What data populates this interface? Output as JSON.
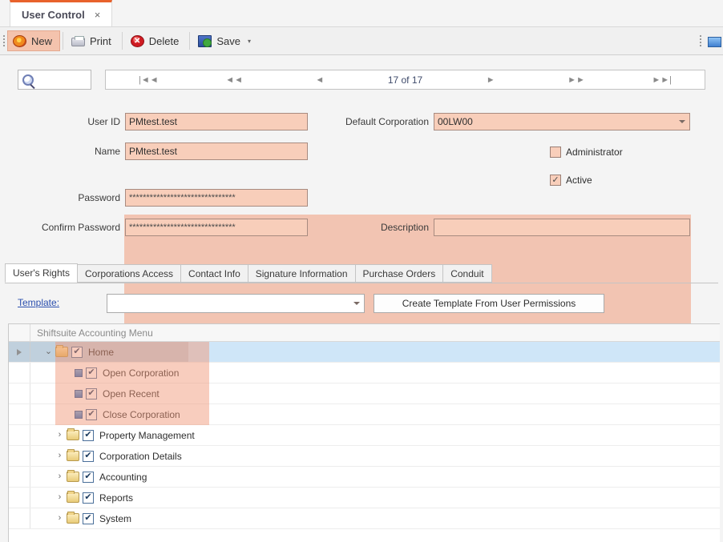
{
  "window": {
    "document_tab": {
      "title": "User Control",
      "close_label": "×"
    }
  },
  "toolbar": {
    "buttons": [
      {
        "label": "New",
        "icon": "new-record-icon",
        "active": true
      },
      {
        "label": "Print",
        "icon": "printer-icon",
        "active": false
      },
      {
        "label": "Delete",
        "icon": "delete-circle-icon",
        "active": false
      },
      {
        "label": "Save",
        "icon": "save-disk-icon",
        "active": false,
        "caret": "▾"
      }
    ]
  },
  "navigator": {
    "search_placeholder": "",
    "search_value": "",
    "first_label": "|◄◄",
    "prev_page_label": "◄◄",
    "prev_label": "◄",
    "position": "17 of 17",
    "next_label": "►",
    "next_page_label": "►►",
    "last_label": "►►|"
  },
  "form": {
    "user_id": {
      "label": "User ID",
      "value": "PMtest.test"
    },
    "name": {
      "label": "Name",
      "value": "PMtest.test"
    },
    "password": {
      "label": "Password",
      "value": "*******************************"
    },
    "confirm_password": {
      "label": "Confirm Password",
      "value": "*******************************"
    },
    "default_corporation": {
      "label": "Default Corporation",
      "value": "00LW00"
    },
    "administrator": {
      "label": "Administrator",
      "checked": false,
      "mark": ""
    },
    "active": {
      "label": "Active",
      "checked": true,
      "mark": "✓"
    },
    "description": {
      "label": "Description",
      "value": ""
    }
  },
  "tabs": [
    {
      "label": "User's Rights",
      "selected": true
    },
    {
      "label": "Corporations Access",
      "selected": false
    },
    {
      "label": "Contact Info",
      "selected": false
    },
    {
      "label": "Signature Information",
      "selected": false
    },
    {
      "label": "Purchase Orders",
      "selected": false
    },
    {
      "label": "Conduit",
      "selected": false
    }
  ],
  "template": {
    "label": "Template:",
    "combo_value": "",
    "create_button": "Create Template From User Permissions"
  },
  "tree": {
    "column_header": "Shiftsuite Accounting Menu",
    "rows": [
      {
        "label": "Home",
        "level": 0,
        "type": "folder-open",
        "expander": "⌄",
        "checked": true,
        "selected": true,
        "highlight": true
      },
      {
        "label": "Open Corporation",
        "level": 1,
        "type": "leaf",
        "expander": "",
        "checked": true,
        "selected": false,
        "highlight": true
      },
      {
        "label": "Open Recent",
        "level": 1,
        "type": "leaf",
        "expander": "",
        "checked": true,
        "selected": false,
        "highlight": true
      },
      {
        "label": "Close Corporation",
        "level": 1,
        "type": "leaf",
        "expander": "",
        "checked": true,
        "selected": false,
        "highlight": true
      },
      {
        "label": "Property Management",
        "level": 0,
        "type": "folder",
        "expander": "›",
        "checked": true,
        "selected": false,
        "highlight": false
      },
      {
        "label": "Corporation Details",
        "level": 0,
        "type": "folder",
        "expander": "›",
        "checked": true,
        "selected": false,
        "highlight": false
      },
      {
        "label": "Accounting",
        "level": 0,
        "type": "folder",
        "expander": "›",
        "checked": true,
        "selected": false,
        "highlight": false
      },
      {
        "label": "Reports",
        "level": 0,
        "type": "folder",
        "expander": "›",
        "checked": true,
        "selected": false,
        "highlight": false
      },
      {
        "label": "System",
        "level": 0,
        "type": "folder",
        "expander": "›",
        "checked": true,
        "selected": false,
        "highlight": false
      }
    ],
    "check_mark": "✔"
  },
  "colors": {
    "accent_orange": "#e8622c",
    "panel_salmon": "#f2c4b2",
    "field_salmon": "#f8ceba",
    "selection_blue": "#cfe6f8",
    "link_blue": "#2b4fae"
  }
}
